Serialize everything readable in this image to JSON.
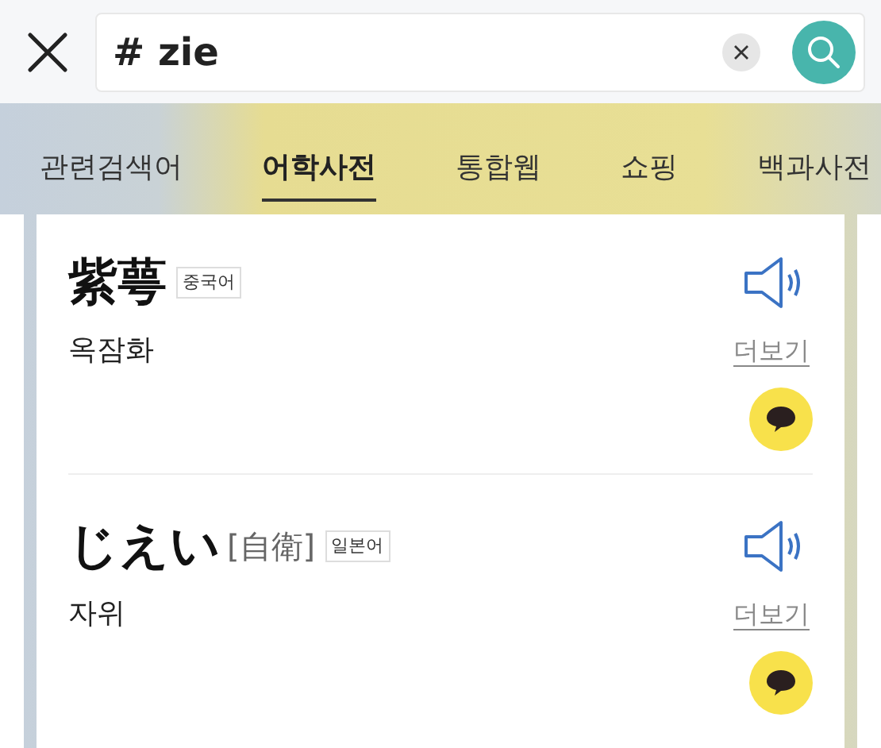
{
  "search": {
    "value": "# zie"
  },
  "tabs": [
    {
      "label": "관련검색어",
      "selected": false
    },
    {
      "label": "어학사전",
      "selected": true
    },
    {
      "label": "통합웹",
      "selected": false
    },
    {
      "label": "쇼핑",
      "selected": false
    },
    {
      "label": "백과사전",
      "selected": false
    }
  ],
  "entries": [
    {
      "word": "紫萼",
      "language": "중국어",
      "meaning": "옥잠화",
      "more": "더보기"
    },
    {
      "word": "じえい",
      "reading": "[自衛]",
      "language": "일본어",
      "meaning": "자위",
      "more": "더보기"
    }
  ]
}
